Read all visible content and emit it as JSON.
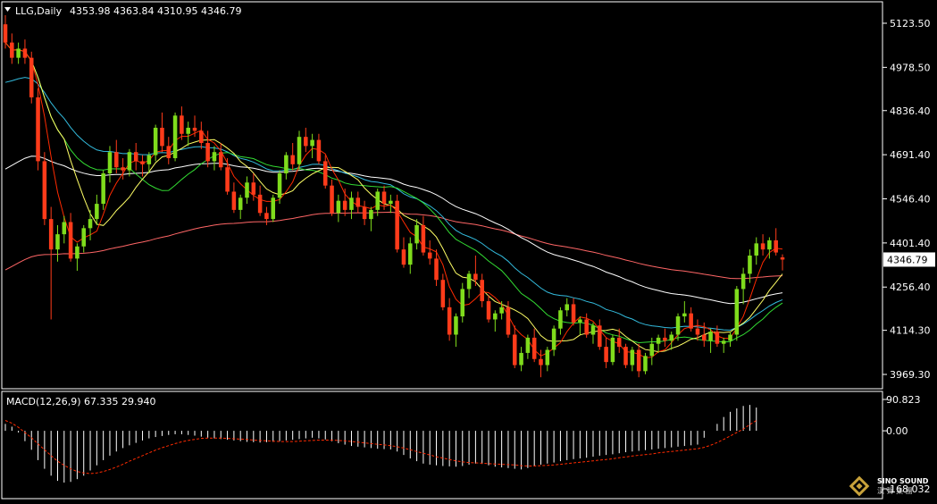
{
  "header": {
    "symbol_timeframe": "LLG,Daily",
    "ohlc": "4353.98 4363.84 4310.95 4346.79",
    "macd_label": "MACD(12,26,9) 67.335 29.940"
  },
  "logo": {
    "text": "SINO SOUND",
    "subtext": "漢 聲 集 團"
  },
  "colors": {
    "background": "#000000",
    "frame": "#ffffff",
    "bull": "#7fdc1c",
    "bear": "#ff3b1a",
    "ma5": "#ff2a00",
    "ma10": "#ffff66",
    "ma20": "#33dd33",
    "ma60": "#33bbdd",
    "ma120": "#ffffff",
    "ma250": "#ff6666",
    "macd_hist": "#ffffff",
    "macd_signal": "#ff2a00"
  },
  "chart_data": [
    {
      "type": "candlestick",
      "symbol": "LLG",
      "timeframe": "Daily",
      "y_ticks": [
        "5123.50",
        "4978.50",
        "4836.40",
        "4691.40",
        "4546.40",
        "4401.40",
        "4256.40",
        "4114.30",
        "3969.30"
      ],
      "ylim": [
        3920,
        5170
      ],
      "last_price": "4346.79",
      "ohlc": [
        [
          5120,
          5150,
          5040,
          5060
        ],
        [
          5060,
          5090,
          4990,
          5010
        ],
        [
          5010,
          5060,
          4990,
          5040
        ],
        [
          5040,
          5070,
          4990,
          5010
        ],
        [
          5010,
          5030,
          4860,
          4880
        ],
        [
          4880,
          4910,
          4640,
          4670
        ],
        [
          4670,
          4700,
          4460,
          4480
        ],
        [
          4480,
          4520,
          4150,
          4380
        ],
        [
          4380,
          4460,
          4340,
          4430
        ],
        [
          4430,
          4490,
          4400,
          4470
        ],
        [
          4470,
          4500,
          4340,
          4350
        ],
        [
          4350,
          4400,
          4310,
          4390
        ],
        [
          4390,
          4460,
          4370,
          4450
        ],
        [
          4450,
          4510,
          4410,
          4480
        ],
        [
          4480,
          4560,
          4460,
          4530
        ],
        [
          4530,
          4640,
          4510,
          4630
        ],
        [
          4630,
          4720,
          4600,
          4700
        ],
        [
          4700,
          4740,
          4630,
          4650
        ],
        [
          4650,
          4680,
          4610,
          4640
        ],
        [
          4640,
          4710,
          4620,
          4700
        ],
        [
          4700,
          4730,
          4640,
          4670
        ],
        [
          4670,
          4690,
          4620,
          4660
        ],
        [
          4660,
          4700,
          4630,
          4690
        ],
        [
          4690,
          4790,
          4670,
          4780
        ],
        [
          4780,
          4830,
          4700,
          4720
        ],
        [
          4720,
          4750,
          4660,
          4680
        ],
        [
          4680,
          4830,
          4670,
          4820
        ],
        [
          4820,
          4850,
          4740,
          4760
        ],
        [
          4760,
          4800,
          4720,
          4780
        ],
        [
          4780,
          4820,
          4750,
          4770
        ],
        [
          4770,
          4800,
          4710,
          4730
        ],
        [
          4730,
          4770,
          4650,
          4670
        ],
        [
          4670,
          4720,
          4640,
          4700
        ],
        [
          4700,
          4730,
          4640,
          4650
        ],
        [
          4650,
          4680,
          4560,
          4570
        ],
        [
          4570,
          4600,
          4500,
          4510
        ],
        [
          4510,
          4560,
          4480,
          4550
        ],
        [
          4550,
          4620,
          4530,
          4600
        ],
        [
          4600,
          4630,
          4540,
          4560
        ],
        [
          4560,
          4590,
          4490,
          4500
        ],
        [
          4500,
          4520,
          4460,
          4480
        ],
        [
          4480,
          4560,
          4470,
          4550
        ],
        [
          4550,
          4640,
          4530,
          4630
        ],
        [
          4630,
          4700,
          4610,
          4690
        ],
        [
          4690,
          4730,
          4640,
          4660
        ],
        [
          4660,
          4770,
          4640,
          4750
        ],
        [
          4750,
          4780,
          4700,
          4720
        ],
        [
          4720,
          4760,
          4680,
          4740
        ],
        [
          4740,
          4760,
          4660,
          4670
        ],
        [
          4670,
          4690,
          4580,
          4590
        ],
        [
          4590,
          4610,
          4490,
          4500
        ],
        [
          4500,
          4560,
          4470,
          4540
        ],
        [
          4540,
          4580,
          4490,
          4510
        ],
        [
          4510,
          4570,
          4480,
          4550
        ],
        [
          4550,
          4570,
          4500,
          4520
        ],
        [
          4520,
          4540,
          4460,
          4480
        ],
        [
          4480,
          4520,
          4440,
          4510
        ],
        [
          4510,
          4580,
          4490,
          4570
        ],
        [
          4570,
          4590,
          4510,
          4530
        ],
        [
          4530,
          4560,
          4500,
          4540
        ],
        [
          4540,
          4560,
          4370,
          4380
        ],
        [
          4380,
          4420,
          4320,
          4330
        ],
        [
          4330,
          4420,
          4300,
          4400
        ],
        [
          4400,
          4480,
          4380,
          4460
        ],
        [
          4460,
          4490,
          4360,
          4370
        ],
        [
          4370,
          4410,
          4330,
          4350
        ],
        [
          4350,
          4380,
          4260,
          4280
        ],
        [
          4280,
          4300,
          4180,
          4190
        ],
        [
          4190,
          4220,
          4080,
          4100
        ],
        [
          4100,
          4170,
          4060,
          4160
        ],
        [
          4160,
          4270,
          4140,
          4250
        ],
        [
          4250,
          4310,
          4220,
          4300
        ],
        [
          4300,
          4360,
          4260,
          4280
        ],
        [
          4280,
          4300,
          4190,
          4210
        ],
        [
          4210,
          4230,
          4140,
          4150
        ],
        [
          4150,
          4180,
          4110,
          4170
        ],
        [
          4170,
          4210,
          4150,
          4190
        ],
        [
          4190,
          4210,
          4090,
          4100
        ],
        [
          4100,
          4130,
          3990,
          4000
        ],
        [
          4000,
          4060,
          3980,
          4040
        ],
        [
          4040,
          4100,
          4020,
          4090
        ],
        [
          4090,
          4120,
          4010,
          4020
        ],
        [
          4020,
          4050,
          3960,
          4000
        ],
        [
          4000,
          4060,
          3980,
          4050
        ],
        [
          4050,
          4130,
          4030,
          4120
        ],
        [
          4120,
          4190,
          4100,
          4180
        ],
        [
          4180,
          4220,
          4160,
          4200
        ],
        [
          4200,
          4220,
          4130,
          4140
        ],
        [
          4140,
          4160,
          4100,
          4150
        ],
        [
          4150,
          4170,
          4090,
          4100
        ],
        [
          4100,
          4140,
          4070,
          4130
        ],
        [
          4130,
          4150,
          4050,
          4060
        ],
        [
          4060,
          4090,
          3990,
          4010
        ],
        [
          4010,
          4100,
          4000,
          4090
        ],
        [
          4090,
          4120,
          4040,
          4060
        ],
        [
          4060,
          4070,
          3990,
          4000
        ],
        [
          4000,
          4060,
          3980,
          4050
        ],
        [
          4050,
          4070,
          3960,
          3980
        ],
        [
          3980,
          4040,
          3970,
          4030
        ],
        [
          4030,
          4090,
          4000,
          4070
        ],
        [
          4070,
          4100,
          4040,
          4090
        ],
        [
          4090,
          4120,
          4060,
          4080
        ],
        [
          4080,
          4110,
          4050,
          4100
        ],
        [
          4100,
          4170,
          4080,
          4160
        ],
        [
          4160,
          4210,
          4140,
          4170
        ],
        [
          4170,
          4190,
          4110,
          4120
        ],
        [
          4120,
          4150,
          4080,
          4100
        ],
        [
          4100,
          4140,
          4060,
          4080
        ],
        [
          4080,
          4120,
          4040,
          4110
        ],
        [
          4110,
          4130,
          4060,
          4070
        ],
        [
          4070,
          4090,
          4040,
          4080
        ],
        [
          4080,
          4110,
          4060,
          4100
        ],
        [
          4100,
          4260,
          4080,
          4250
        ],
        [
          4250,
          4320,
          4200,
          4300
        ],
        [
          4300,
          4380,
          4270,
          4360
        ],
        [
          4360,
          4420,
          4330,
          4400
        ],
        [
          4400,
          4430,
          4360,
          4380
        ],
        [
          4380,
          4420,
          4350,
          4410
        ],
        [
          4410,
          4450,
          4360,
          4370
        ],
        [
          4353.98,
          4363.84,
          4310.95,
          4346.79
        ]
      ]
    },
    {
      "type": "bar",
      "indicator": "MACD",
      "params": [
        12,
        26,
        9
      ],
      "macd_value": 67.335,
      "signal_value": 29.94,
      "y_ticks": [
        "90.823",
        "0.00",
        "-168.032"
      ],
      "ylim": [
        -168.032,
        90.823
      ],
      "histogram": [
        20,
        12,
        -5,
        -30,
        -55,
        -85,
        -110,
        -130,
        -145,
        -150,
        -148,
        -140,
        -130,
        -115,
        -100,
        -85,
        -72,
        -60,
        -50,
        -42,
        -35,
        -28,
        -22,
        -18,
        -15,
        -12,
        -10,
        -10,
        -12,
        -14,
        -17,
        -20,
        -22,
        -24,
        -26,
        -28,
        -30,
        -32,
        -33,
        -34,
        -33,
        -32,
        -30,
        -28,
        -26,
        -24,
        -22,
        -20,
        -22,
        -25,
        -30,
        -36,
        -40,
        -44,
        -46,
        -48,
        -50,
        -52,
        -53,
        -54,
        -60,
        -70,
        -80,
        -88,
        -95,
        -98,
        -100,
        -102,
        -103,
        -104,
        -102,
        -98,
        -95,
        -96,
        -100,
        -104,
        -106,
        -108,
        -110,
        -112,
        -108,
        -102,
        -98,
        -95,
        -92,
        -88,
        -85,
        -82,
        -80,
        -78,
        -75,
        -72,
        -70,
        -68,
        -65,
        -62,
        -60,
        -58,
        -56,
        -54,
        -52,
        -50,
        -48,
        -46,
        -44,
        -42,
        -40,
        -20,
        0,
        20,
        40,
        55,
        65,
        72,
        75,
        67.335
      ],
      "signal": [
        30,
        22,
        10,
        -5,
        -20,
        -38,
        -55,
        -72,
        -88,
        -100,
        -110,
        -118,
        -122,
        -124,
        -122,
        -118,
        -112,
        -105,
        -97,
        -88,
        -80,
        -72,
        -64,
        -56,
        -49,
        -43,
        -37,
        -32,
        -28,
        -25,
        -22,
        -21,
        -21,
        -21,
        -22,
        -23,
        -24,
        -25,
        -27,
        -28,
        -29,
        -30,
        -31,
        -31,
        -31,
        -30,
        -29,
        -28,
        -27,
        -27,
        -27,
        -28,
        -29,
        -31,
        -33,
        -35,
        -37,
        -39,
        -41,
        -43,
        -46,
        -50,
        -55,
        -60,
        -65,
        -70,
        -75,
        -79,
        -83,
        -87,
        -90,
        -92,
        -93,
        -94,
        -95,
        -96,
        -97,
        -98,
        -99,
        -101,
        -102,
        -102,
        -101,
        -100,
        -99,
        -97,
        -95,
        -93,
        -91,
        -89,
        -87,
        -85,
        -83,
        -81,
        -78,
        -76,
        -73,
        -71,
        -69,
        -67,
        -64,
        -62,
        -60,
        -58,
        -56,
        -54,
        -52,
        -48,
        -42,
        -34,
        -25,
        -15,
        -5,
        5,
        18,
        29.94
      ]
    }
  ]
}
